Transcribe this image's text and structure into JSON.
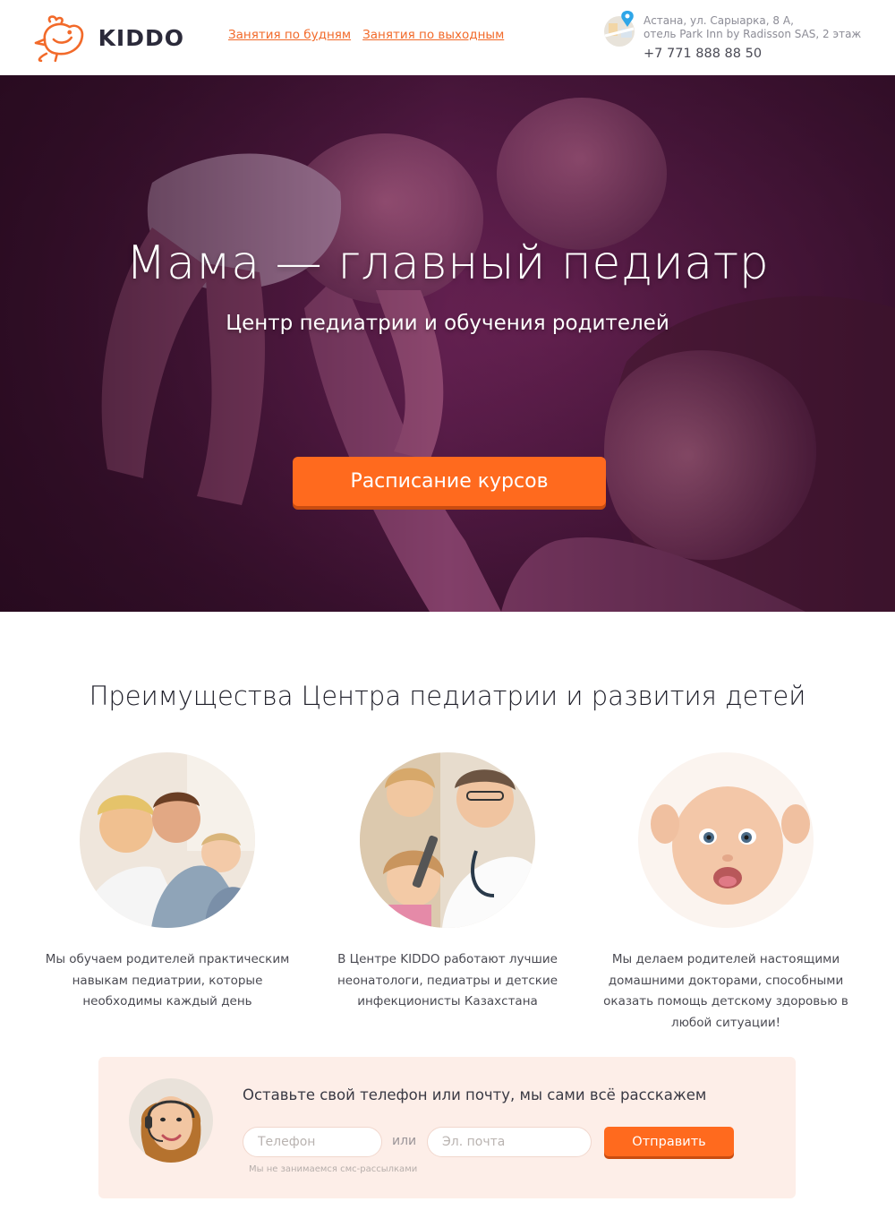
{
  "brand": {
    "name": "KIDDO",
    "accent": "#f26a2a",
    "button_color": "#ff6a1e"
  },
  "nav": {
    "weekdays": "Занятия по будням",
    "weekends": "Занятия по выходным"
  },
  "contact": {
    "address_line1": "Астана, ул. Сарыарка, 8 А,",
    "address_line2": "отель Park Inn by Radisson SAS, 2 этаж",
    "phone": "+7 771 888 88 50"
  },
  "hero": {
    "title": "Мама — главный педиатр",
    "subtitle": "Центр педиатрии и обучения родителей",
    "cta": "Расписание курсов"
  },
  "advantages": {
    "title": "Преимущества Центра педиатрии и развития детей",
    "items": [
      {
        "text": "Мы обучаем родителей практическим навыкам педиатрии, которые необходимы каждый день"
      },
      {
        "text": "В Центре KIDDO работают лучшие неонатологи, педиатры и детские инфекционисты Казахстана"
      },
      {
        "text": "Мы делаем родителей настоящими домашними докторами, способными оказать помощь детскому здоровью в любой ситуации!"
      }
    ]
  },
  "form": {
    "heading": "Оставьте свой телефон или почту, мы сами всё расскажем",
    "phone_placeholder": "Телефон",
    "or": "или",
    "email_placeholder": "Эл. почта",
    "submit": "Отправить",
    "note": "Мы не занимаемся смс-рассылками"
  }
}
